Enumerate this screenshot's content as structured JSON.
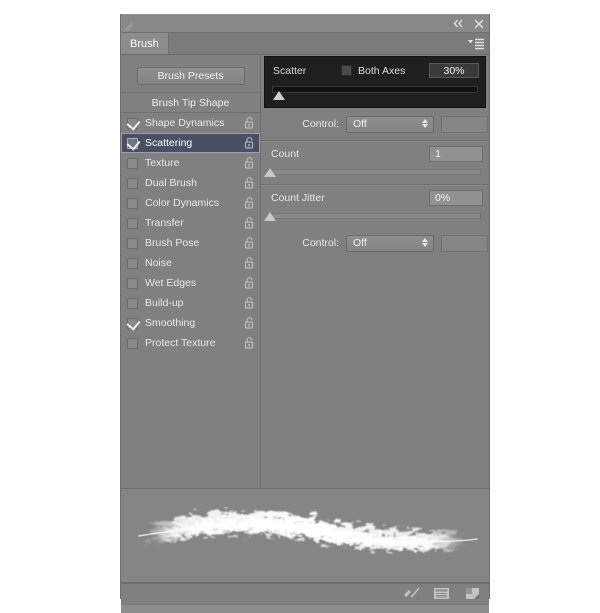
{
  "window": {
    "title": "Brush",
    "collapse_icon": "double-chevron-left-icon",
    "close_icon": "close-icon",
    "menu_icon": "panel-menu-icon"
  },
  "tabs": [
    {
      "label": "Brush",
      "active": true
    }
  ],
  "sidebar": {
    "presets_button": "Brush Presets",
    "section_header": "Brush Tip Shape",
    "items": [
      {
        "label": "Shape Dynamics",
        "checked": true,
        "selected": false,
        "lock": "lock-icon"
      },
      {
        "label": "Scattering",
        "checked": true,
        "selected": true,
        "lock": "lock-icon"
      },
      {
        "label": "Texture",
        "checked": false,
        "selected": false,
        "lock": "lock-icon"
      },
      {
        "label": "Dual Brush",
        "checked": false,
        "selected": false,
        "lock": "lock-icon"
      },
      {
        "label": "Color Dynamics",
        "checked": false,
        "selected": false,
        "lock": "lock-icon"
      },
      {
        "label": "Transfer",
        "checked": false,
        "selected": false,
        "lock": "lock-icon"
      },
      {
        "label": "Brush Pose",
        "checked": false,
        "selected": false,
        "lock": "lock-icon"
      },
      {
        "label": "Noise",
        "checked": false,
        "selected": false,
        "lock": "lock-icon"
      },
      {
        "label": "Wet Edges",
        "checked": false,
        "selected": false,
        "lock": "lock-icon"
      },
      {
        "label": "Build-up",
        "checked": false,
        "selected": false,
        "lock": "lock-icon"
      },
      {
        "label": "Smoothing",
        "checked": true,
        "selected": false,
        "lock": "lock-icon"
      },
      {
        "label": "Protect Texture",
        "checked": false,
        "selected": false,
        "lock": "lock-icon"
      }
    ]
  },
  "settings": {
    "scatter": {
      "label": "Scatter",
      "both_axes_label": "Both Axes",
      "both_axes_checked": false,
      "value": "30%",
      "slider_percent": 3
    },
    "scatter_control": {
      "label": "Control:",
      "value": "Off"
    },
    "count": {
      "label": "Count",
      "value": "1",
      "slider_percent": 0
    },
    "count_jitter": {
      "label": "Count Jitter",
      "value": "0%",
      "slider_percent": 0
    },
    "count_jitter_control": {
      "label": "Control:",
      "value": "Off"
    }
  },
  "footer": {
    "icons": [
      {
        "name": "toggle-brush-panel-icon"
      },
      {
        "name": "brush-preset-picker-icon"
      },
      {
        "name": "create-new-brush-icon"
      }
    ]
  },
  "colors": {
    "panel_bg": "#808080",
    "panel_bg_dark": "#1f1f1f",
    "selection_bg": "#4a4f63",
    "text": "#e8e8e8",
    "accent_text": "#ffffff",
    "preview_bg": "#858585"
  }
}
